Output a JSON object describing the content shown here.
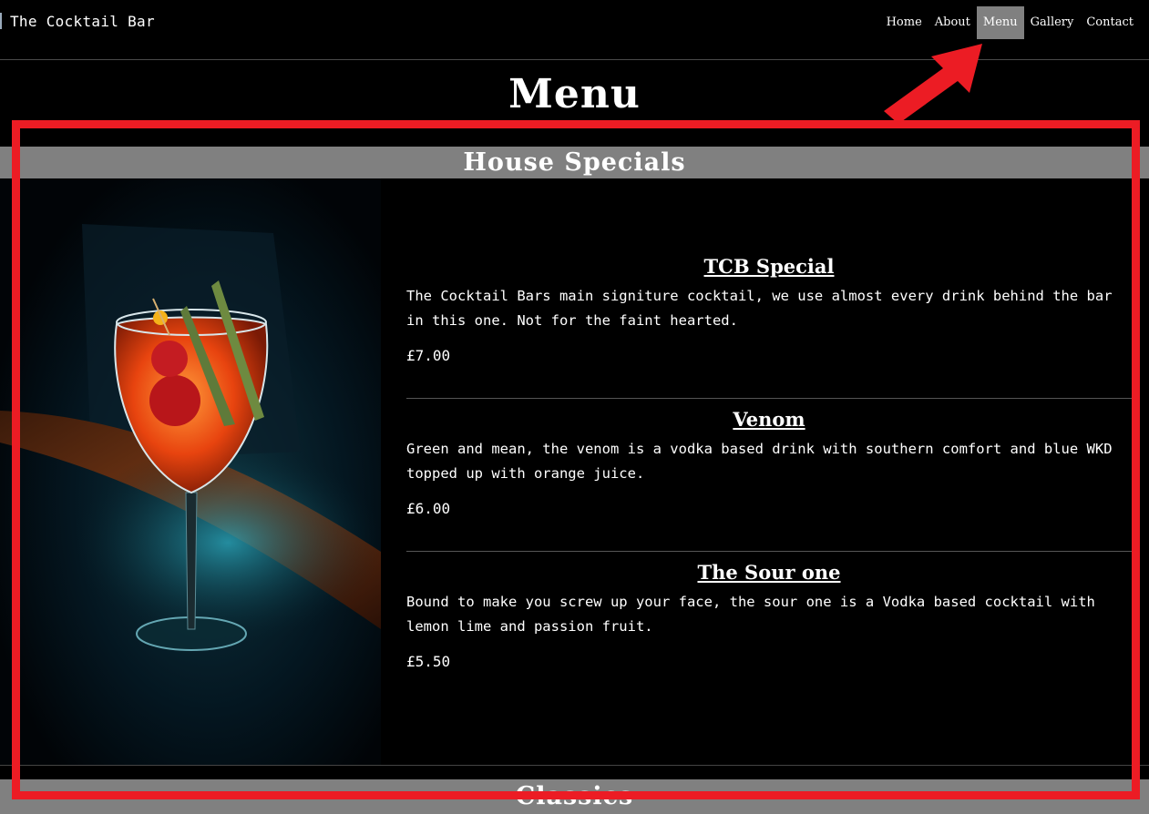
{
  "brand": "The Cocktail Bar",
  "nav": {
    "home": "Home",
    "about": "About",
    "menu": "Menu",
    "gallery": "Gallery",
    "contact": "Contact"
  },
  "page_title": "Menu",
  "sections": {
    "specials": "House Specials",
    "classics": "Classics"
  },
  "items": [
    {
      "name": "TCB Special",
      "description": "The Cocktail Bars main signiture cocktail, we use almost every drink behind the bar in this one. Not for the faint hearted.",
      "price": "£7.00"
    },
    {
      "name": "Venom",
      "description": "Green and mean, the venom is a vodka based drink with southern comfort and blue WKD topped up with orange juice.",
      "price": "£6.00"
    },
    {
      "name": "The Sour one",
      "description": "Bound to make you screw up your face, the sour one is a Vodka based cocktail with lemon lime and passion fruit.",
      "price": "£5.50"
    }
  ],
  "colors": {
    "background": "#000000",
    "nav_active": "#808080",
    "section_bar": "#808080",
    "annotation_red": "#ec1c24"
  }
}
